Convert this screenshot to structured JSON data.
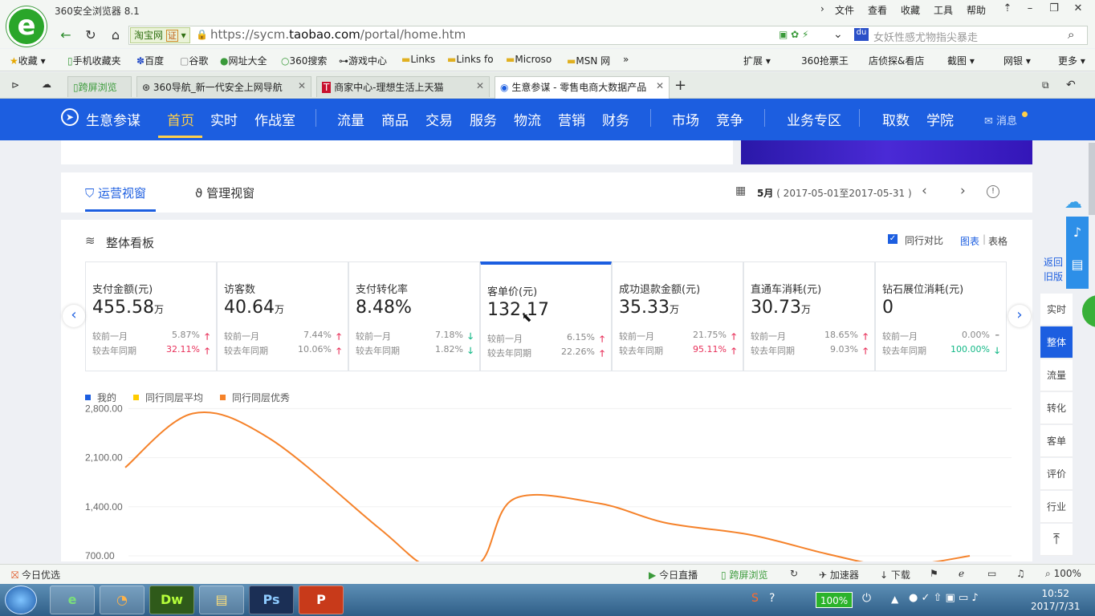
{
  "browser": {
    "title": "360安全浏览器 8.1",
    "menus": [
      "文件",
      "查看",
      "收藏",
      "工具",
      "帮助"
    ],
    "address": {
      "badge": "淘宝网",
      "badge_tag": "证",
      "url_prefix": "https://sycm.",
      "url_domain": "taobao.com",
      "url_path": "/portal/home.htm"
    },
    "search_placeholder": "女妖性感尤物指尖暴走",
    "bookmarks": [
      "收藏",
      "手机收藏夹",
      "百度",
      "谷歌",
      "网址大全",
      "360搜索",
      "游戏中心",
      "Links",
      "Links fo",
      "Microso",
      "MSN 网"
    ],
    "bookmarks_right": [
      "扩展",
      "360抢票王",
      "店侦探&看店",
      "截图",
      "网银",
      "更多"
    ],
    "tabs": [
      {
        "label": "跨屏浏览"
      },
      {
        "label": "360导航_新一代安全上网导航"
      },
      {
        "label": "商家中心-理想生活上天猫"
      },
      {
        "label": "生意参谋 - 零售电商大数据产品"
      }
    ]
  },
  "app": {
    "brand": "生意参谋",
    "nav": [
      "首页",
      "实时",
      "作战室",
      "流量",
      "商品",
      "交易",
      "服务",
      "物流",
      "营销",
      "财务",
      "市场",
      "竞争",
      "业务专区",
      "取数",
      "学院"
    ],
    "message": "消息"
  },
  "view_tabs": [
    "运营视窗",
    "管理视窗"
  ],
  "date": {
    "label": "5月",
    "range": "( 2017-05-01至2017-05-31 )"
  },
  "board": {
    "title": "整体看板",
    "compare_label": "同行对比",
    "view_chart": "图表",
    "view_table": "表格",
    "compare_labels": [
      "较前一月",
      "较去年同期"
    ],
    "metrics": [
      {
        "label": "支付金额(元)",
        "value": "455.58",
        "unit": "万",
        "r1": "5.87%",
        "d1": "up",
        "r2": "32.11%",
        "d2": "up",
        "c2": "red"
      },
      {
        "label": "访客数",
        "value": "40.64",
        "unit": "万",
        "r1": "7.44%",
        "d1": "up",
        "r2": "10.06%",
        "d2": "up",
        "c2": "gray"
      },
      {
        "label": "支付转化率",
        "value": "8.48%",
        "unit": "",
        "r1": "7.18%",
        "d1": "down",
        "r2": "1.82%",
        "d2": "down",
        "c2": "gray"
      },
      {
        "label": "客单价(元)",
        "value": "132.17",
        "unit": "",
        "r1": "6.15%",
        "d1": "up",
        "r2": "22.26%",
        "d2": "up",
        "c2": "gray"
      },
      {
        "label": "成功退款金额(元)",
        "value": "35.33",
        "unit": "万",
        "r1": "21.75%",
        "d1": "up",
        "r2": "95.11%",
        "d2": "up",
        "c2": "red"
      },
      {
        "label": "直通车消耗(元)",
        "value": "30.73",
        "unit": "万",
        "r1": "18.65%",
        "d1": "up",
        "r2": "9.03%",
        "d2": "up",
        "c2": "gray"
      },
      {
        "label": "钻石展位消耗(元)",
        "value": "0",
        "unit": "",
        "r1": "0.00%",
        "d1": "flat",
        "r2": "100.00%",
        "d2": "down",
        "c2": "green"
      }
    ]
  },
  "legend": [
    {
      "name": "我的",
      "color": "#1c5ee0"
    },
    {
      "name": "同行同层平均",
      "color": "#ffcc00"
    },
    {
      "name": "同行同层优秀",
      "color": "#f5822a"
    }
  ],
  "chart_data": {
    "type": "line",
    "yticks": [
      "2,800.00",
      "2,100.00",
      "1,400.00",
      "700.00"
    ],
    "ytick_values": [
      2800,
      2100,
      1400,
      700
    ],
    "ylim_visible": [
      620,
      2850
    ],
    "series": [
      {
        "name": "同行同层优秀",
        "color": "#f5822a",
        "points": [
          [
            0.0,
            1960
          ],
          [
            0.08,
            2730
          ],
          [
            0.17,
            2380
          ],
          [
            0.3,
            1100
          ],
          [
            0.36,
            540
          ],
          [
            0.42,
            600
          ],
          [
            0.46,
            1510
          ],
          [
            0.56,
            1450
          ],
          [
            0.64,
            1170
          ],
          [
            0.74,
            1000
          ],
          [
            0.83,
            730
          ],
          [
            0.9,
            560
          ],
          [
            0.95,
            600
          ],
          [
            1.0,
            700
          ]
        ]
      }
    ]
  },
  "sidebar": {
    "back": "返回旧版",
    "items": [
      "实时",
      "整体",
      "流量",
      "转化",
      "客单",
      "评价",
      "行业"
    ],
    "active": "整体"
  },
  "statusbar": {
    "left": "今日优选",
    "items": [
      "今日直播",
      "跨屏浏览",
      "加速器",
      "下载"
    ],
    "zoom": "100%"
  },
  "taskbar": {
    "battery": "100%",
    "time": "10:52",
    "date": "2017/7/31"
  }
}
